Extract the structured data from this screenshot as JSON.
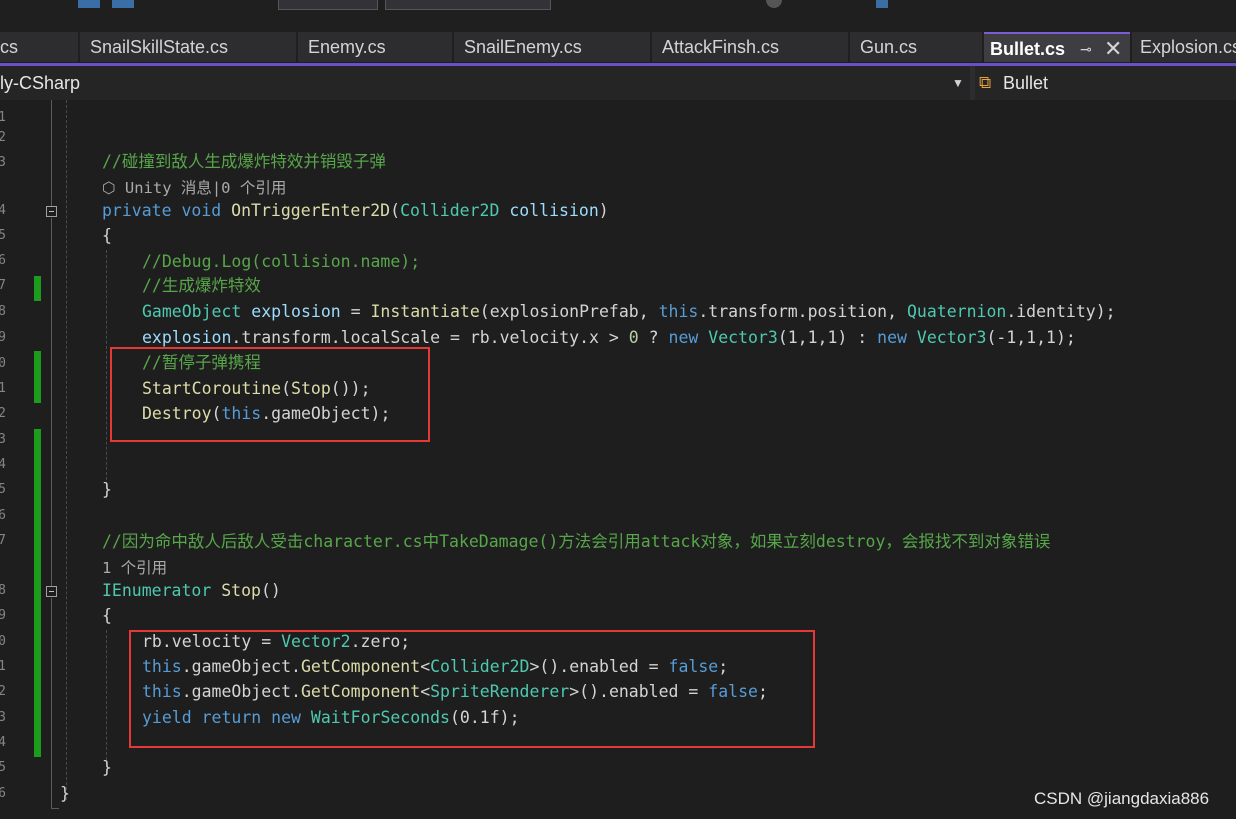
{
  "tabs": [
    {
      "label": "cs"
    },
    {
      "label": "SnailSkillState.cs"
    },
    {
      "label": "Enemy.cs"
    },
    {
      "label": "SnailEnemy.cs"
    },
    {
      "label": "AttackFinsh.cs"
    },
    {
      "label": "Gun.cs"
    },
    {
      "label": "Bullet.cs",
      "active": true
    },
    {
      "label": "Explosion.cs"
    }
  ],
  "nav": {
    "project": "ly-CSharp",
    "class_name": "Bullet",
    "class_icon": "class-icon"
  },
  "line_numbers": [
    "1",
    "2",
    "3",
    "4",
    "5",
    "6",
    "7",
    "8",
    "9",
    "0",
    "1",
    "2",
    "3",
    "4",
    "5",
    "6",
    "7",
    "8",
    "9",
    "0",
    "1",
    "2",
    "3",
    "4",
    "5",
    "6"
  ],
  "code": {
    "line1": "//碰撞到敌人生成爆炸特效并销毁子弹",
    "lens1": "⬡ Unity 消息|0 个引用",
    "line2": [
      {
        "t": "private",
        "c": "k"
      },
      {
        "t": " ",
        "c": "p"
      },
      {
        "t": "void",
        "c": "k"
      },
      {
        "t": " ",
        "c": "p"
      },
      {
        "t": "OnTriggerEnter2D",
        "c": "m"
      },
      {
        "t": "(",
        "c": "p"
      },
      {
        "t": "Collider2D",
        "c": "t"
      },
      {
        "t": " ",
        "c": "p"
      },
      {
        "t": "collision",
        "c": "v"
      },
      {
        "t": ")",
        "c": "p"
      }
    ],
    "line3": "{",
    "line4": "//Debug.Log(collision.name);",
    "line5": "//生成爆炸特效",
    "line6": [
      {
        "t": "GameObject",
        "c": "t"
      },
      {
        "t": " ",
        "c": "p"
      },
      {
        "t": "explosion",
        "c": "v"
      },
      {
        "t": " = ",
        "c": "p"
      },
      {
        "t": "Instantiate",
        "c": "m"
      },
      {
        "t": "(explosionPrefab, ",
        "c": "p"
      },
      {
        "t": "this",
        "c": "k"
      },
      {
        "t": ".transform.position, ",
        "c": "p"
      },
      {
        "t": "Quaternion",
        "c": "t"
      },
      {
        "t": ".identity);",
        "c": "p"
      }
    ],
    "line7": [
      {
        "t": "explosion",
        "c": "v"
      },
      {
        "t": ".transform.localScale = rb.velocity.x > ",
        "c": "p"
      },
      {
        "t": "0",
        "c": "n"
      },
      {
        "t": " ? ",
        "c": "p"
      },
      {
        "t": "new",
        "c": "k"
      },
      {
        "t": " ",
        "c": "p"
      },
      {
        "t": "Vector3",
        "c": "t"
      },
      {
        "t": "(1,1,1) : ",
        "c": "p"
      },
      {
        "t": "new",
        "c": "k"
      },
      {
        "t": " ",
        "c": "p"
      },
      {
        "t": "Vector3",
        "c": "t"
      },
      {
        "t": "(-1,1,1);",
        "c": "p"
      }
    ],
    "line8": "//暂停子弹携程",
    "line9": [
      {
        "t": "StartCoroutine",
        "c": "m"
      },
      {
        "t": "(",
        "c": "p"
      },
      {
        "t": "Stop",
        "c": "m"
      },
      {
        "t": "());",
        "c": "p"
      }
    ],
    "line10": [
      {
        "t": "Destroy",
        "c": "m"
      },
      {
        "t": "(",
        "c": "p"
      },
      {
        "t": "this",
        "c": "k"
      },
      {
        "t": ".gameObject);",
        "c": "p"
      }
    ],
    "line11": "}",
    "line12": "//因为命中敌人后敌人受击character.cs中TakeDamage()方法会引用attack对象，如果立刻destroy，会报找不到对象错误",
    "lens2": "1 个引用",
    "line13": [
      {
        "t": "IEnumerator",
        "c": "t"
      },
      {
        "t": " ",
        "c": "p"
      },
      {
        "t": "Stop",
        "c": "m"
      },
      {
        "t": "()",
        "c": "p"
      }
    ],
    "line14": "{",
    "line15": [
      {
        "t": "rb.velocity = ",
        "c": "p"
      },
      {
        "t": "Vector2",
        "c": "t"
      },
      {
        "t": ".zero;",
        "c": "p"
      }
    ],
    "line16": [
      {
        "t": "this",
        "c": "k"
      },
      {
        "t": ".gameObject.",
        "c": "p"
      },
      {
        "t": "GetComponent",
        "c": "m"
      },
      {
        "t": "<",
        "c": "p"
      },
      {
        "t": "Collider2D",
        "c": "t"
      },
      {
        "t": ">().enabled = ",
        "c": "p"
      },
      {
        "t": "false",
        "c": "k"
      },
      {
        "t": ";",
        "c": "p"
      }
    ],
    "line17": [
      {
        "t": "this",
        "c": "k"
      },
      {
        "t": ".gameObject.",
        "c": "p"
      },
      {
        "t": "GetComponent",
        "c": "m"
      },
      {
        "t": "<",
        "c": "p"
      },
      {
        "t": "SpriteRenderer",
        "c": "t"
      },
      {
        "t": ">().enabled = ",
        "c": "p"
      },
      {
        "t": "false",
        "c": "k"
      },
      {
        "t": ";",
        "c": "p"
      }
    ],
    "line18": [
      {
        "t": "yield",
        "c": "k"
      },
      {
        "t": " ",
        "c": "p"
      },
      {
        "t": "return",
        "c": "k"
      },
      {
        "t": " ",
        "c": "p"
      },
      {
        "t": "new",
        "c": "k"
      },
      {
        "t": " ",
        "c": "p"
      },
      {
        "t": "WaitForSeconds",
        "c": "t"
      },
      {
        "t": "(0.1f);",
        "c": "p"
      }
    ],
    "line19": "}",
    "line20": "}"
  },
  "watermark": "CSDN @jiangdaxia886",
  "colors": {
    "keyword": "#569cd6",
    "type": "#4ec9b0",
    "method": "#dcdcaa",
    "variable": "#9cdcfe",
    "comment": "#57a64a",
    "highlight_box": "#e53935",
    "change_marker": "#1d9b1d"
  }
}
